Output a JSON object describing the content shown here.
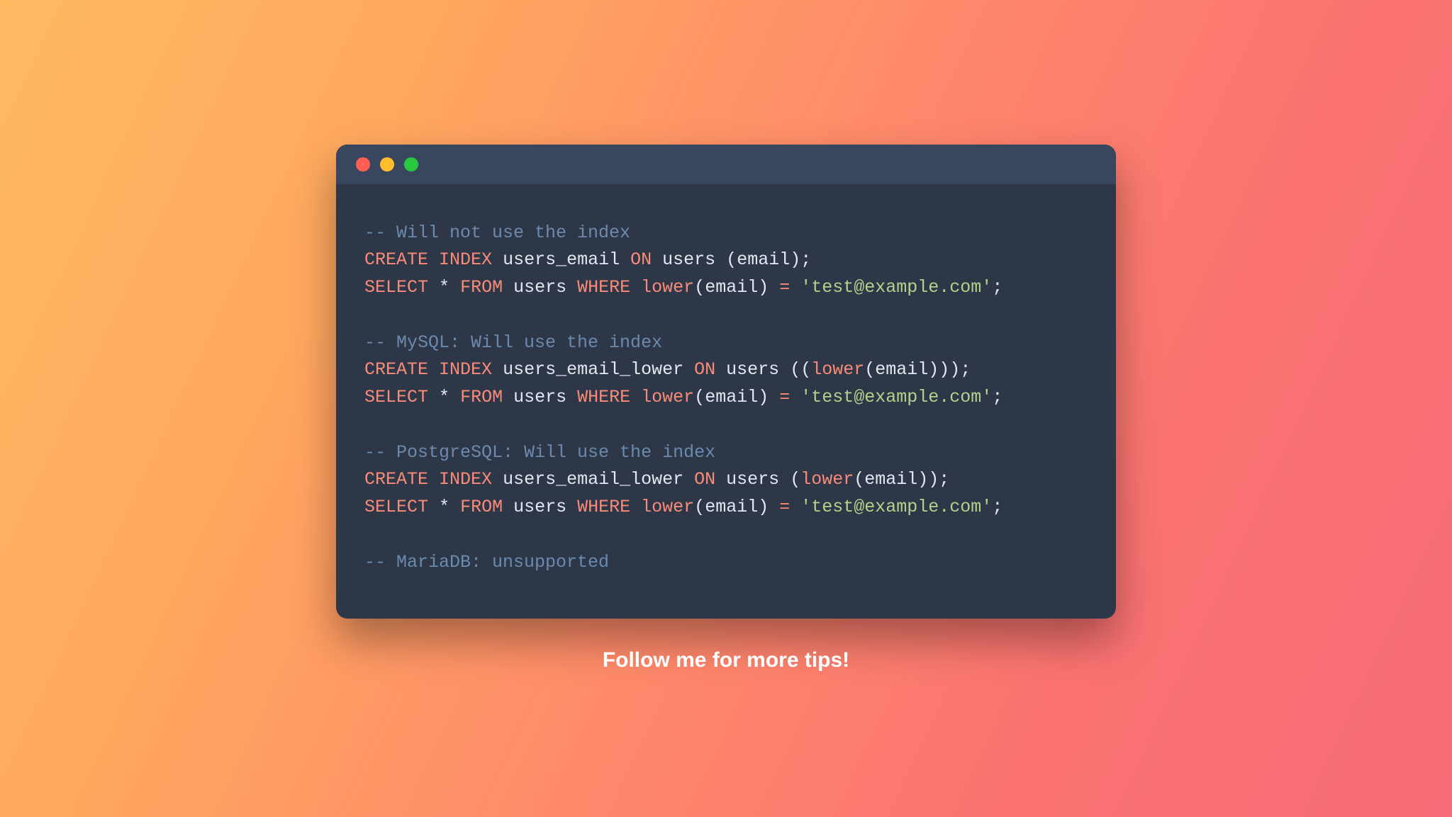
{
  "window": {
    "traffic_lights": {
      "red": "close",
      "yellow": "minimize",
      "green": "maximize"
    }
  },
  "code": {
    "lines": [
      {
        "type": "comment",
        "tokens": [
          {
            "t": "comment",
            "v": "-- Will not use the index"
          }
        ]
      },
      {
        "type": "stmt",
        "tokens": [
          {
            "t": "keyword",
            "v": "CREATE"
          },
          {
            "t": "space",
            "v": " "
          },
          {
            "t": "keyword",
            "v": "INDEX"
          },
          {
            "t": "space",
            "v": " "
          },
          {
            "t": "ident",
            "v": "users_email"
          },
          {
            "t": "space",
            "v": " "
          },
          {
            "t": "keyword",
            "v": "ON"
          },
          {
            "t": "space",
            "v": " "
          },
          {
            "t": "ident",
            "v": "users"
          },
          {
            "t": "space",
            "v": " "
          },
          {
            "t": "punct",
            "v": "("
          },
          {
            "t": "ident",
            "v": "email"
          },
          {
            "t": "punct",
            "v": ")"
          },
          {
            "t": "punct",
            "v": ";"
          }
        ]
      },
      {
        "type": "stmt",
        "tokens": [
          {
            "t": "keyword",
            "v": "SELECT"
          },
          {
            "t": "space",
            "v": " "
          },
          {
            "t": "star",
            "v": "*"
          },
          {
            "t": "space",
            "v": " "
          },
          {
            "t": "keyword",
            "v": "FROM"
          },
          {
            "t": "space",
            "v": " "
          },
          {
            "t": "ident",
            "v": "users"
          },
          {
            "t": "space",
            "v": " "
          },
          {
            "t": "keyword",
            "v": "WHERE"
          },
          {
            "t": "space",
            "v": " "
          },
          {
            "t": "func",
            "v": "lower"
          },
          {
            "t": "punct",
            "v": "("
          },
          {
            "t": "ident",
            "v": "email"
          },
          {
            "t": "punct",
            "v": ")"
          },
          {
            "t": "space",
            "v": " "
          },
          {
            "t": "op",
            "v": "="
          },
          {
            "t": "space",
            "v": " "
          },
          {
            "t": "string",
            "v": "'test@example.com'"
          },
          {
            "t": "punct",
            "v": ";"
          }
        ]
      },
      {
        "type": "blank",
        "tokens": [
          {
            "t": "space",
            "v": " "
          }
        ]
      },
      {
        "type": "comment",
        "tokens": [
          {
            "t": "comment",
            "v": "-- MySQL: Will use the index"
          }
        ]
      },
      {
        "type": "stmt",
        "tokens": [
          {
            "t": "keyword",
            "v": "CREATE"
          },
          {
            "t": "space",
            "v": " "
          },
          {
            "t": "keyword",
            "v": "INDEX"
          },
          {
            "t": "space",
            "v": " "
          },
          {
            "t": "ident",
            "v": "users_email_lower"
          },
          {
            "t": "space",
            "v": " "
          },
          {
            "t": "keyword",
            "v": "ON"
          },
          {
            "t": "space",
            "v": " "
          },
          {
            "t": "ident",
            "v": "users"
          },
          {
            "t": "space",
            "v": " "
          },
          {
            "t": "punct",
            "v": "("
          },
          {
            "t": "punct",
            "v": "("
          },
          {
            "t": "func",
            "v": "lower"
          },
          {
            "t": "punct",
            "v": "("
          },
          {
            "t": "ident",
            "v": "email"
          },
          {
            "t": "punct",
            "v": ")"
          },
          {
            "t": "punct",
            "v": ")"
          },
          {
            "t": "punct",
            "v": ")"
          },
          {
            "t": "punct",
            "v": ";"
          }
        ]
      },
      {
        "type": "stmt",
        "tokens": [
          {
            "t": "keyword",
            "v": "SELECT"
          },
          {
            "t": "space",
            "v": " "
          },
          {
            "t": "star",
            "v": "*"
          },
          {
            "t": "space",
            "v": " "
          },
          {
            "t": "keyword",
            "v": "FROM"
          },
          {
            "t": "space",
            "v": " "
          },
          {
            "t": "ident",
            "v": "users"
          },
          {
            "t": "space",
            "v": " "
          },
          {
            "t": "keyword",
            "v": "WHERE"
          },
          {
            "t": "space",
            "v": " "
          },
          {
            "t": "func",
            "v": "lower"
          },
          {
            "t": "punct",
            "v": "("
          },
          {
            "t": "ident",
            "v": "email"
          },
          {
            "t": "punct",
            "v": ")"
          },
          {
            "t": "space",
            "v": " "
          },
          {
            "t": "op",
            "v": "="
          },
          {
            "t": "space",
            "v": " "
          },
          {
            "t": "string",
            "v": "'test@example.com'"
          },
          {
            "t": "punct",
            "v": ";"
          }
        ]
      },
      {
        "type": "blank",
        "tokens": [
          {
            "t": "space",
            "v": " "
          }
        ]
      },
      {
        "type": "comment",
        "tokens": [
          {
            "t": "comment",
            "v": "-- PostgreSQL: Will use the index"
          }
        ]
      },
      {
        "type": "stmt",
        "tokens": [
          {
            "t": "keyword",
            "v": "CREATE"
          },
          {
            "t": "space",
            "v": " "
          },
          {
            "t": "keyword",
            "v": "INDEX"
          },
          {
            "t": "space",
            "v": " "
          },
          {
            "t": "ident",
            "v": "users_email_lower"
          },
          {
            "t": "space",
            "v": " "
          },
          {
            "t": "keyword",
            "v": "ON"
          },
          {
            "t": "space",
            "v": " "
          },
          {
            "t": "ident",
            "v": "users"
          },
          {
            "t": "space",
            "v": " "
          },
          {
            "t": "punct",
            "v": "("
          },
          {
            "t": "func",
            "v": "lower"
          },
          {
            "t": "punct",
            "v": "("
          },
          {
            "t": "ident",
            "v": "email"
          },
          {
            "t": "punct",
            "v": ")"
          },
          {
            "t": "punct",
            "v": ")"
          },
          {
            "t": "punct",
            "v": ";"
          }
        ]
      },
      {
        "type": "stmt",
        "tokens": [
          {
            "t": "keyword",
            "v": "SELECT"
          },
          {
            "t": "space",
            "v": " "
          },
          {
            "t": "star",
            "v": "*"
          },
          {
            "t": "space",
            "v": " "
          },
          {
            "t": "keyword",
            "v": "FROM"
          },
          {
            "t": "space",
            "v": " "
          },
          {
            "t": "ident",
            "v": "users"
          },
          {
            "t": "space",
            "v": " "
          },
          {
            "t": "keyword",
            "v": "WHERE"
          },
          {
            "t": "space",
            "v": " "
          },
          {
            "t": "func",
            "v": "lower"
          },
          {
            "t": "punct",
            "v": "("
          },
          {
            "t": "ident",
            "v": "email"
          },
          {
            "t": "punct",
            "v": ")"
          },
          {
            "t": "space",
            "v": " "
          },
          {
            "t": "op",
            "v": "="
          },
          {
            "t": "space",
            "v": " "
          },
          {
            "t": "string",
            "v": "'test@example.com'"
          },
          {
            "t": "punct",
            "v": ";"
          }
        ]
      },
      {
        "type": "blank",
        "tokens": [
          {
            "t": "space",
            "v": " "
          }
        ]
      },
      {
        "type": "comment",
        "tokens": [
          {
            "t": "comment",
            "v": "-- MariaDB: unsupported"
          }
        ]
      }
    ]
  },
  "footer": {
    "cta": "Follow me for more tips!"
  }
}
